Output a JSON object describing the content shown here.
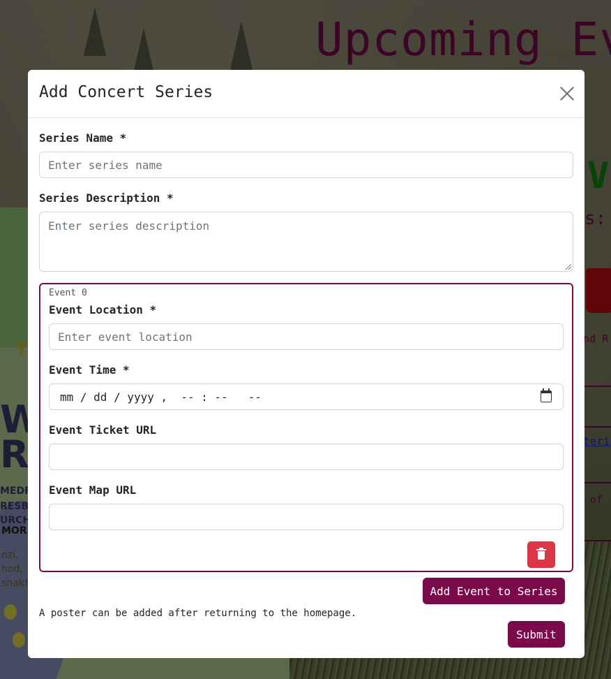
{
  "background": {
    "heading": "Upcoming Eve",
    "green_fragment": "V",
    "colon_fragment": "s:",
    "text_fragment_1": "nd R",
    "link_fragment": "teri",
    "text_fragment_2": "of",
    "poster_lines": [
      "T",
      "W",
      "R",
      "MEDFO",
      "RESBY",
      "URCH C",
      "MORE",
      "nzi,",
      "hod,",
      "snak!"
    ]
  },
  "modal": {
    "title": "Add Concert Series",
    "close_label": "×",
    "series_name": {
      "label": "Series Name *",
      "placeholder": "Enter series name",
      "value": ""
    },
    "series_description": {
      "label": "Series Description *",
      "placeholder": "Enter series description",
      "value": ""
    },
    "events": [
      {
        "legend": "Event 0",
        "location": {
          "label": "Event Location *",
          "placeholder": "Enter event location",
          "value": ""
        },
        "time": {
          "label": "Event Time *",
          "display": "mm / dd / yyyy ,  -- : --   --"
        },
        "ticket_url": {
          "label": "Event Ticket URL",
          "value": ""
        },
        "map_url": {
          "label": "Event Map URL",
          "value": ""
        }
      }
    ],
    "add_event_button": "Add Event to Series",
    "poster_note": "A poster can be added after returning to the homepage.",
    "submit_button": "Submit",
    "colors": {
      "accent": "#7a0a4a",
      "danger": "#dc3545"
    }
  }
}
